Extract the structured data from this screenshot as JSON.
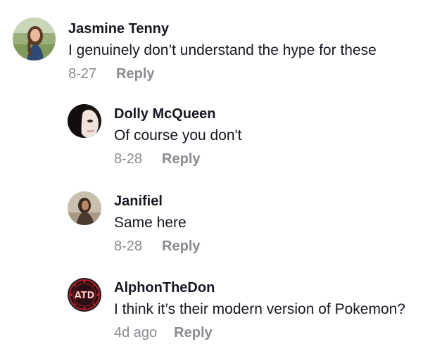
{
  "comments": [
    {
      "username": "Jasmine Tenny",
      "text": "I genuinely don’t understand the hype for these",
      "date": "8-27",
      "reply_label": "Reply"
    },
    {
      "username": "Dolly McQueen",
      "text": "Of course you don't",
      "date": "8-28",
      "reply_label": "Reply"
    },
    {
      "username": "Janifiel",
      "text": "Same here",
      "date": "8-28",
      "reply_label": "Reply"
    },
    {
      "username": "AlphonTheDon",
      "text": "I think it’s their modern version of Pokemon?",
      "date": "4d ago",
      "reply_label": "Reply",
      "avatar_text": "ATD"
    }
  ]
}
